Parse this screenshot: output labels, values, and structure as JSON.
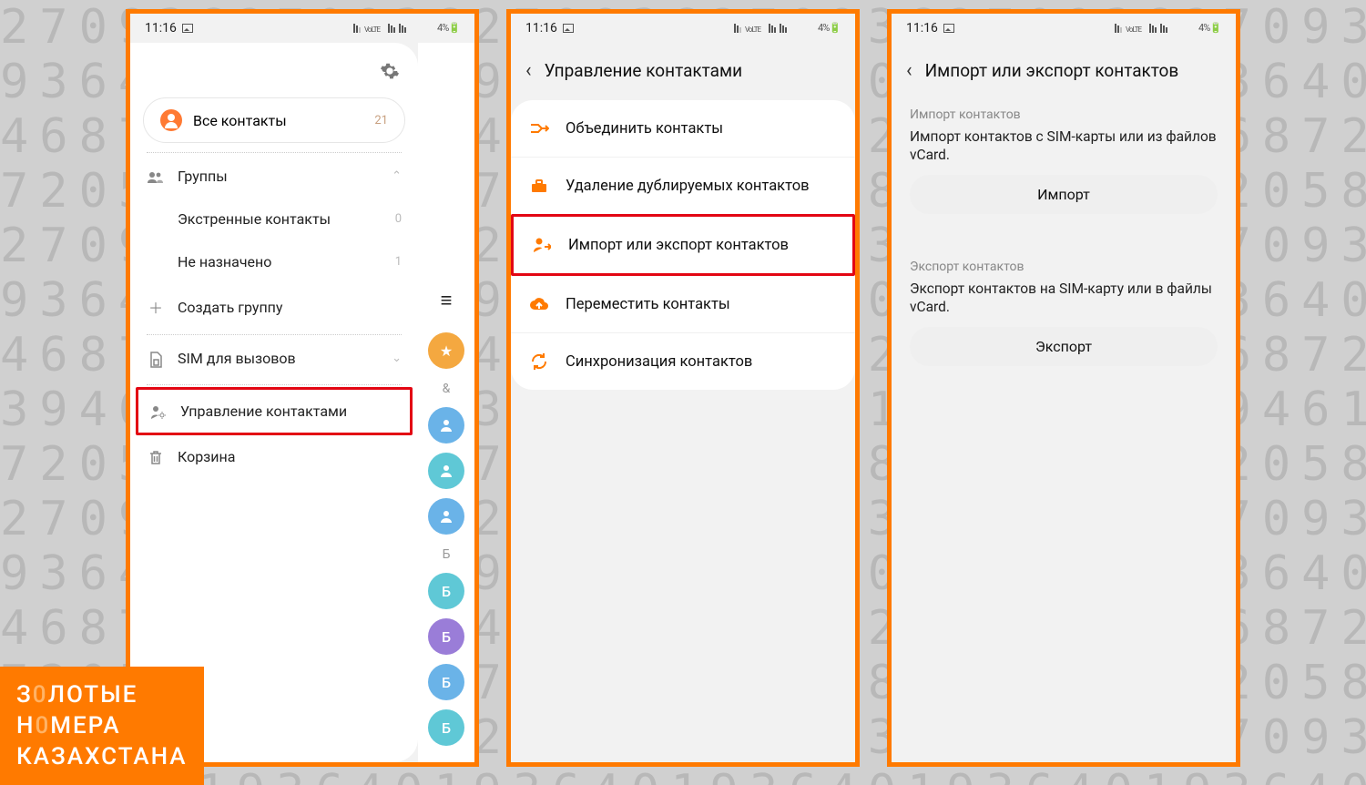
{
  "background_rows": [
    "270936",
    "936401",
    "468725",
    "720583",
    "270936",
    "936401",
    "468725",
    "394618",
    "720583"
  ],
  "watermark": {
    "line1_pre": "З",
    "line1_accent": "0",
    "line1_post": "ЛОТЫЕ",
    "line2_pre": "Н",
    "line2_accent": "0",
    "line2_post": "МЕРА",
    "line3": "КАЗАХСТАНА"
  },
  "status": {
    "time": "11:16",
    "right": "4%"
  },
  "phone1": {
    "all_contacts": "Все контакты",
    "all_contacts_count": "21",
    "groups": "Группы",
    "emergency": "Экстренные контакты",
    "emergency_count": "0",
    "unassigned": "Не назначено",
    "unassigned_count": "1",
    "create_group": "Создать группу",
    "sim": "SIM для вызовов",
    "manage": "Управление контактами",
    "trash": "Корзина",
    "index_letters": [
      "&",
      "Б"
    ],
    "bubble_letters": [
      "Б",
      "Б",
      "Б",
      "Б"
    ]
  },
  "phone2": {
    "title": "Управление контактами",
    "merge": "Объединить контакты",
    "dedupe": "Удаление дублируемых контактов",
    "import_export": "Импорт или экспорт контактов",
    "move": "Переместить контакты",
    "sync": "Синхронизация контактов"
  },
  "phone3": {
    "title": "Импорт или экспорт контактов",
    "import_section": "Импорт контактов",
    "import_desc": "Импорт контактов с SIM-карты или из файлов vCard.",
    "import_btn": "Импорт",
    "export_section": "Экспорт контактов",
    "export_desc": "Экспорт контактов на SIM-карту или в файлы vCard.",
    "export_btn": "Экспорт"
  }
}
